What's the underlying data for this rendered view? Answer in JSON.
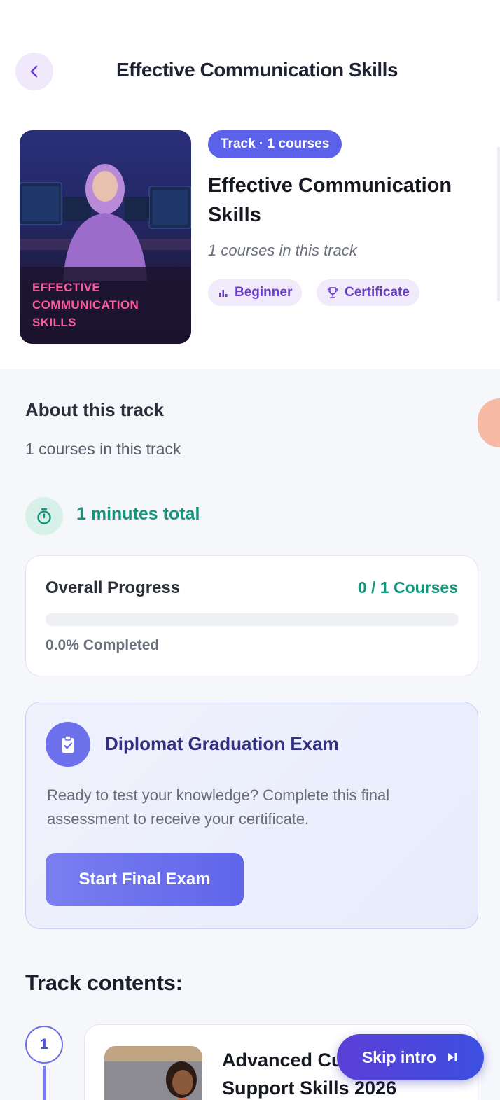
{
  "header": {
    "title": "Effective Communication Skills"
  },
  "track": {
    "cover_text": "EFFECTIVE\nCOMMUNICATION\nSKILLS",
    "pill": "Track · 1 courses",
    "name": "Effective Communication Skills",
    "subtitle": "1 courses in this track",
    "tags": {
      "level": "Beginner",
      "certificate": "Certificate"
    }
  },
  "about": {
    "title": "About this track",
    "text": "1 courses in this track",
    "duration": "1 minutes total"
  },
  "progress": {
    "label": "Overall Progress",
    "count": "0 / 1 Courses",
    "percent_text": "0.0% Completed",
    "fraction": 0.0
  },
  "exam": {
    "title": "Diplomat Graduation Exam",
    "description": "Ready to test your knowledge? Complete this final assessment to receive your certificate.",
    "button": "Start Final Exam"
  },
  "contents": {
    "title": "Track contents:",
    "items": [
      {
        "number": "1",
        "title": "Advanced Customer Support Skills 2026"
      }
    ]
  },
  "skip": {
    "label": "Skip intro"
  },
  "colors": {
    "accent": "#5b61e8",
    "success": "#15957a",
    "tag_text": "#6a3dc9",
    "cover_text": "#ff5a9e"
  },
  "icons": {
    "back": "chevron-left-icon",
    "level": "bar-chart-icon",
    "certificate": "trophy-icon",
    "duration": "stopwatch-icon",
    "exam": "clipboard-check-icon",
    "skip": "skip-forward-icon"
  }
}
